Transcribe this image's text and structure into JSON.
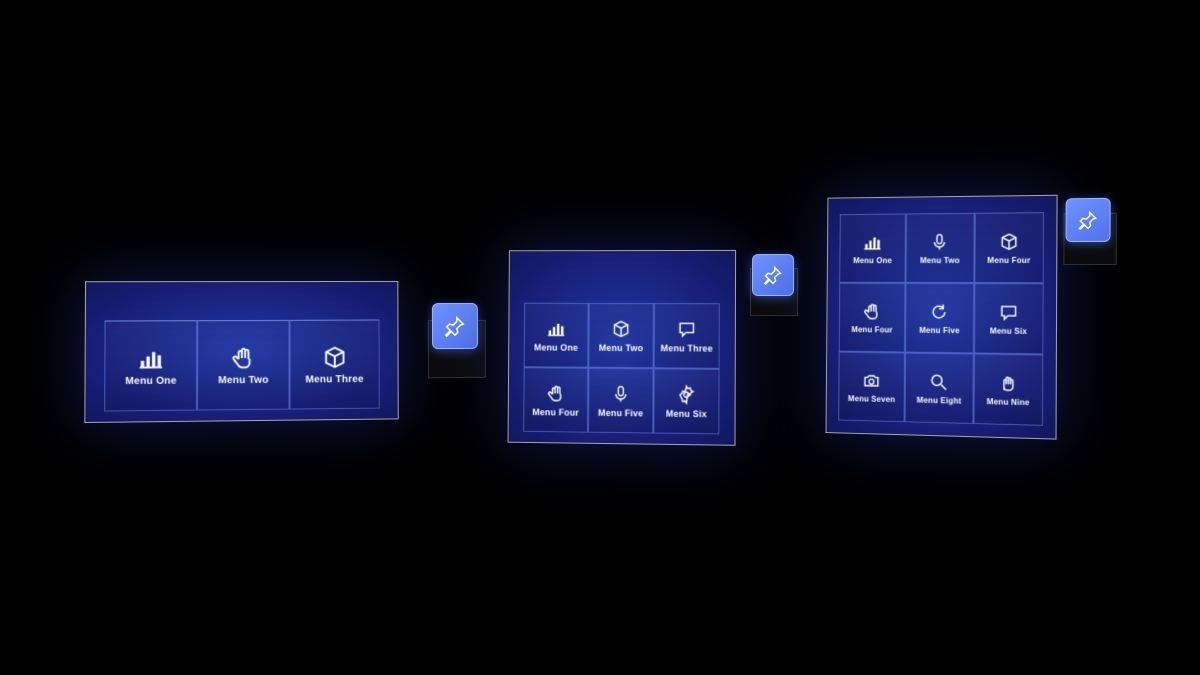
{
  "panels": [
    {
      "id": "menu-1x3",
      "buttons": [
        {
          "label": "Menu One",
          "icon": "bar-chart-icon"
        },
        {
          "label": "Menu Two",
          "icon": "hand-icon"
        },
        {
          "label": "Menu Three",
          "icon": "cube-icon"
        }
      ]
    },
    {
      "id": "menu-2x3",
      "buttons": [
        {
          "label": "Menu One",
          "icon": "bar-chart-icon"
        },
        {
          "label": "Menu Two",
          "icon": "cube-icon"
        },
        {
          "label": "Menu Three",
          "icon": "comment-icon"
        },
        {
          "label": "Menu Four",
          "icon": "hand-icon"
        },
        {
          "label": "Menu Five",
          "icon": "microphone-icon"
        },
        {
          "label": "Menu Six",
          "icon": "gear-icon"
        }
      ]
    },
    {
      "id": "menu-3x3",
      "buttons": [
        {
          "label": "Menu One",
          "icon": "bar-chart-icon"
        },
        {
          "label": "Menu Two",
          "icon": "microphone-icon"
        },
        {
          "label": "Menu Four",
          "icon": "cube-icon"
        },
        {
          "label": "Menu Four",
          "icon": "hand-icon"
        },
        {
          "label": "Menu Five",
          "icon": "refresh-icon"
        },
        {
          "label": "Menu Six",
          "icon": "comment-icon"
        },
        {
          "label": "Menu Seven",
          "icon": "camera-icon"
        },
        {
          "label": "Menu Eight",
          "icon": "search-icon"
        },
        {
          "label": "Menu Nine",
          "icon": "hand-fingers-icon"
        }
      ]
    }
  ],
  "pin_label": "Pin",
  "colors": {
    "panel_gradient_center": "#2139a8",
    "panel_gradient_edge": "#10185e",
    "pin_button": "#5a7bf0",
    "background": "#000000"
  }
}
